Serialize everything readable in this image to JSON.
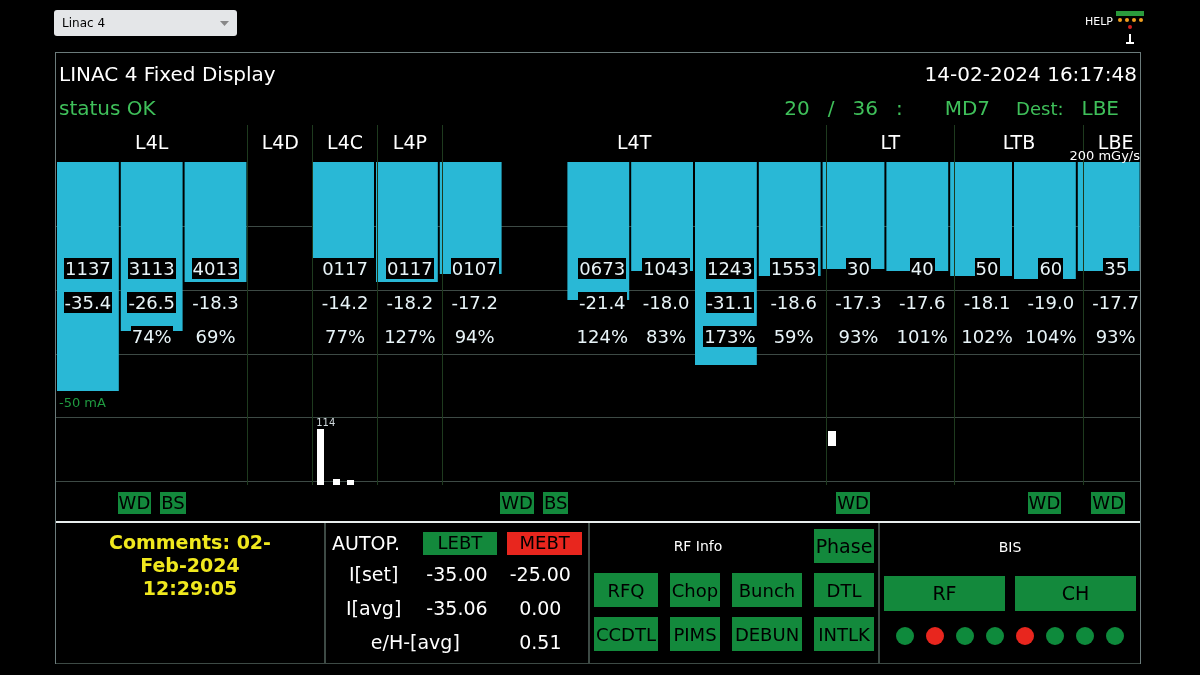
{
  "selector": {
    "value": "Linac 4"
  },
  "help": {
    "label": "HELP"
  },
  "header": {
    "title": "LINAC 4 Fixed Display",
    "datetime": "14-02-2024 16:17:48",
    "status": "status OK",
    "cycle": "20",
    "separator": "/",
    "total": "36",
    "colon": ":",
    "user": "MD7",
    "dest_label": "Dest:",
    "dest": "LBE"
  },
  "chart": {
    "scale_label": "200 mGy/s",
    "current_label": "-50 mA",
    "groups": [
      {
        "label": "L4L",
        "columns": [
          {
            "count": "1137",
            "value": "-35.4"
          },
          {
            "count": "3113",
            "value": "-26.5",
            "percent": "74%",
            "tags": [
              "WD",
              "BS"
            ]
          },
          {
            "count": "4013",
            "value": "-18.3",
            "percent": "69%"
          }
        ]
      },
      {
        "label": "L4D",
        "columns": [
          {}
        ]
      },
      {
        "label": "L4C",
        "columns": [
          {
            "count": "0117",
            "value": "-14.2",
            "percent": "77%",
            "peak": "114"
          }
        ]
      },
      {
        "label": "L4P",
        "columns": [
          {
            "count": "0117",
            "value": "-18.2",
            "percent": "127%"
          }
        ]
      },
      {
        "label": "L4T",
        "columns": [
          {
            "count": "0107",
            "value": "-17.2",
            "percent": "94%"
          },
          {
            "tags": [
              "WD",
              "BS"
            ]
          },
          {
            "count": "0673",
            "value": "-21.4",
            "percent": "124%"
          },
          {
            "count": "1043",
            "value": "-18.0",
            "percent": "83%"
          },
          {
            "count": "1243",
            "value": "-31.1",
            "percent": "173%"
          },
          {
            "count": "1553",
            "value": "-18.6",
            "percent": "59%"
          }
        ]
      },
      {
        "label": "LT",
        "columns": [
          {
            "count": "30",
            "value": "-17.3",
            "percent": "93%",
            "tags": [
              "WD"
            ]
          },
          {
            "count": "40",
            "value": "-17.6",
            "percent": "101%"
          }
        ]
      },
      {
        "label": "LTB",
        "columns": [
          {
            "count": "50",
            "value": "-18.1",
            "percent": "102%"
          },
          {
            "count": "60",
            "value": "-19.0",
            "percent": "104%",
            "tags": [
              "WD"
            ]
          }
        ]
      },
      {
        "label": "LBE",
        "columns": [
          {
            "count": "35",
            "value": "-17.7",
            "percent": "93%",
            "tags": [
              "WD"
            ]
          }
        ]
      }
    ]
  },
  "comments": {
    "text": "Comments: 02-Feb-2024 12:29:05"
  },
  "autopilot": {
    "label": "AUTOP.",
    "sources": [
      {
        "name": "LEBT",
        "alarm": false
      },
      {
        "name": "MEBT",
        "alarm": true
      }
    ],
    "rows": [
      {
        "label": "I[set]",
        "values": [
          "-35.00",
          "-25.00"
        ]
      },
      {
        "label": "I[avg]",
        "values": [
          "-35.06",
          "0.00"
        ]
      },
      {
        "label": "e/H-[avg]",
        "values": [
          "0.51"
        ]
      }
    ]
  },
  "rf_info": {
    "title": "RF Info",
    "phase": "Phase",
    "buttons": [
      "RFQ",
      "Chop",
      "Bunch",
      "DTL",
      "CCDTL",
      "PIMS",
      "DEBUN",
      "INTLK"
    ]
  },
  "bis": {
    "title": "BIS",
    "buttons": [
      "RF",
      "CH"
    ],
    "lights": [
      {
        "color": "#0e8a3c"
      },
      {
        "color": "#e8261e"
      },
      {
        "color": "#0e8a3c"
      },
      {
        "color": "#0e8a3c"
      },
      {
        "color": "#e8261e"
      },
      {
        "color": "#0e8a3c"
      },
      {
        "color": "#0e8a3c"
      },
      {
        "color": "#0e8a3c"
      }
    ]
  }
}
